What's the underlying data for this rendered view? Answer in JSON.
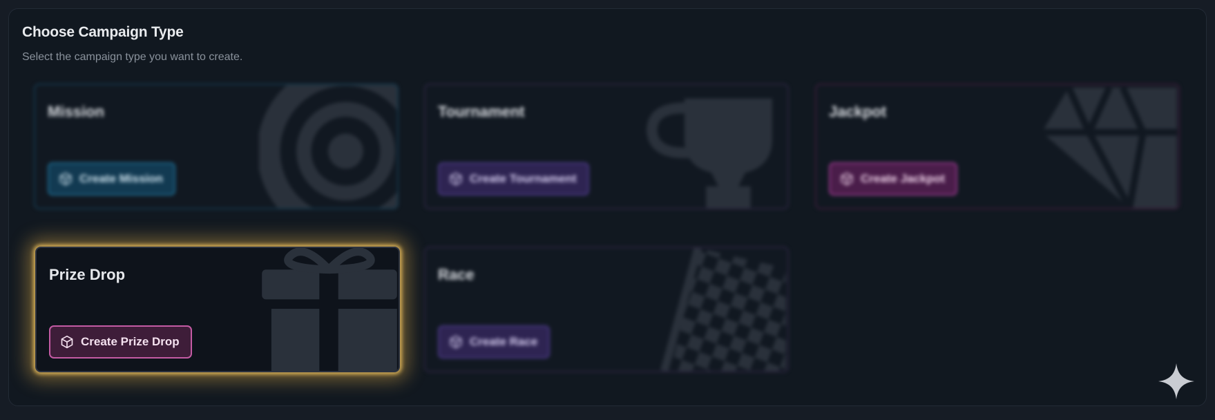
{
  "header": {
    "title": "Choose Campaign Type",
    "subtitle": "Select the campaign type you want to create."
  },
  "cards": [
    {
      "name": "Mission",
      "button_label": "Create Mission",
      "icon": "target-icon",
      "accent": "#1d6a8e",
      "selected": false
    },
    {
      "name": "Tournament",
      "button_label": "Create Tournament",
      "icon": "trophy-icon",
      "accent": "#4a3a86",
      "selected": false
    },
    {
      "name": "Jackpot",
      "button_label": "Create Jackpot",
      "icon": "diamond-icon",
      "accent": "#9a3a8e",
      "selected": false
    },
    {
      "name": "Prize Drop",
      "button_label": "Create Prize Drop",
      "icon": "gift-icon",
      "accent": "#c45ba4",
      "selected": true
    },
    {
      "name": "Race",
      "button_label": "Create Race",
      "icon": "checkered-flag-icon",
      "accent": "#4a3a86",
      "selected": false
    }
  ],
  "button_icon": "cube-icon",
  "highlight_color": "#e8bc5c",
  "corner_icon": "sparkle-icon"
}
